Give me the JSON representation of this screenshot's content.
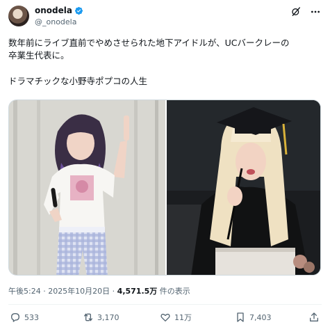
{
  "author": {
    "display_name": "onodela",
    "handle": "@_onodela",
    "avatar_icon": "avatar-photo",
    "verified_icon": "verified-badge-icon",
    "verified_color": "#1d9bf0"
  },
  "header_icons": [
    "grok-icon",
    "more-icon"
  ],
  "tweet": {
    "line1": "数年前にライブ直前でやめさせられた地下アイドルが、UCバークレーの",
    "line2": "卒業生代表に。",
    "line3": "ドラマチックな小野寺ポプコの人生"
  },
  "media": {
    "left_icon": "idol-performer-photo",
    "right_icon": "graduation-speech-photo"
  },
  "meta": {
    "timestamp": "午後5:24 · 2025年10月20日 · ",
    "views_count": "4,571.5万",
    "views_label": " 件の表示"
  },
  "actions": {
    "replies": "533",
    "reposts": "3,170",
    "likes": "11万",
    "bookmarks": "7,403"
  },
  "colors": {
    "text": "#0f1419",
    "secondary": "#536471",
    "accent": "#1d9bf0"
  }
}
